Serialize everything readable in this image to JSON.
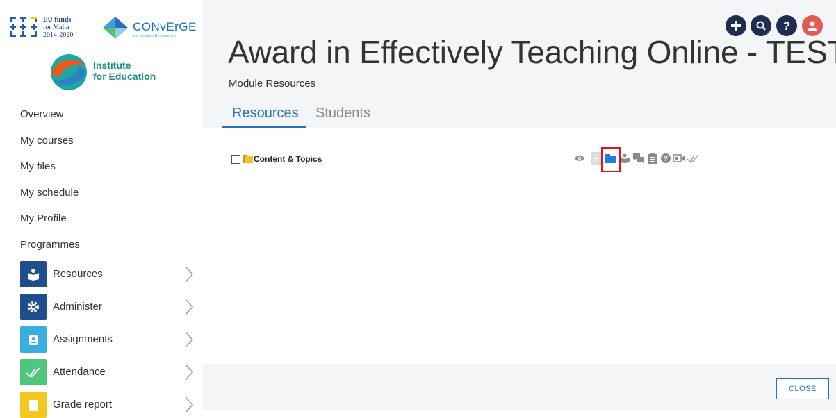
{
  "sidebar": {
    "eu_logo": {
      "line1": "EU funds",
      "line2": "for Malta",
      "line3": "2014-2020"
    },
    "converge_logo": {
      "name": "CONvErGE",
      "tagline": "connected eGovernment"
    },
    "ife_logo": {
      "line1": "Institute",
      "line2": "for Education"
    },
    "nav": [
      "Overview",
      "My courses",
      "My files",
      "My schedule",
      "My Profile",
      "Programmes"
    ],
    "modules": [
      {
        "label": "Resources",
        "icon": "resources-icon",
        "color": "#1f4e8c"
      },
      {
        "label": "Administer",
        "icon": "gear-icon",
        "color": "#1f4e8c"
      },
      {
        "label": "Assignments",
        "icon": "clipboard-icon",
        "color": "#3aaedc"
      },
      {
        "label": "Attendance",
        "icon": "checkmark-icon",
        "color": "#4fc77a"
      },
      {
        "label": "Grade report",
        "icon": "grade-icon",
        "color": "#f2c81e"
      }
    ]
  },
  "header": {
    "title": "Award in Effectively Teaching Online - TEST",
    "subtitle": "Module Resources",
    "toolbar_icons": [
      "add-icon",
      "search-icon",
      "help-icon",
      "user-icon"
    ],
    "toolbar_colors": {
      "dark": "#1f2d4e",
      "user": "#e45a54"
    }
  },
  "tabs": [
    {
      "label": "Resources",
      "active": true
    },
    {
      "label": "Students",
      "active": false
    }
  ],
  "resources": [
    {
      "name": "Content & Topics",
      "type": "folder"
    }
  ],
  "actions": [
    "eye-icon",
    "add-icon",
    "folder-icon",
    "resource-icon",
    "discussion-icon",
    "assignment-icon",
    "quiz-icon",
    "video-icon",
    "attendance-icon"
  ],
  "footer": {
    "close_label": "CLOSE"
  },
  "colors": {
    "accent": "#2a73b8",
    "highlight": "#e0141e"
  }
}
